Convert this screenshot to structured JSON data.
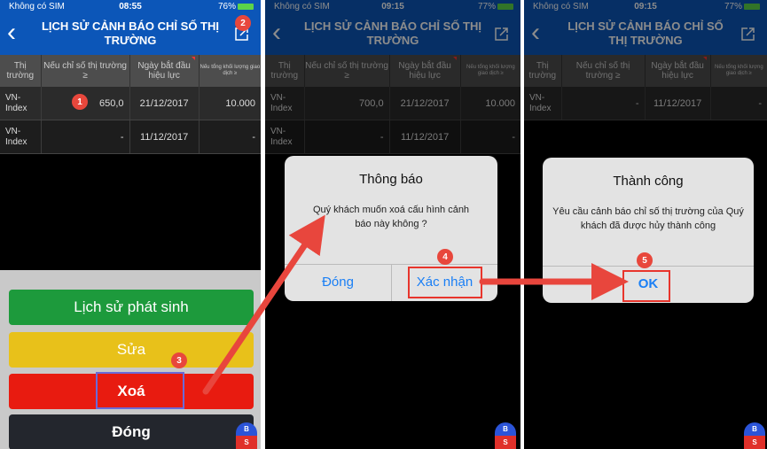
{
  "header": {
    "title": "LỊCH SỬ CẢNH BÁO CHỈ SỐ THỊ TRƯỜNG"
  },
  "columns": {
    "c1": "Thị trường",
    "c2": "Nếu chỉ số thị trường ≥",
    "c3": "Ngày bắt đầu hiệu lực",
    "c4": "Nếu tổng khối lượng giao dịch ≥"
  },
  "screen1": {
    "status": {
      "carrier": "Không có SIM",
      "time": "08:55",
      "battery": "76%"
    },
    "rows": [
      {
        "market": "VN-Index",
        "threshold": "650,0",
        "date": "21/12/2017",
        "volume": "10.000"
      },
      {
        "market": "VN-Index",
        "threshold": "-",
        "date": "11/12/2017",
        "volume": "-"
      }
    ],
    "actions": {
      "history": "Lịch sử phát sinh",
      "edit": "Sửa",
      "delete": "Xoá",
      "close": "Đóng"
    },
    "badges": {
      "b1": "1",
      "b2": "2",
      "b3": "3"
    }
  },
  "screen2": {
    "status": {
      "carrier": "Không có SIM",
      "time": "09:15",
      "battery": "77%"
    },
    "rows": [
      {
        "market": "VN-Index",
        "threshold": "700,0",
        "date": "21/12/2017",
        "volume": "10.000"
      },
      {
        "market": "VN-Index",
        "threshold": "-",
        "date": "11/12/2017",
        "volume": "-"
      }
    ],
    "dialog": {
      "title": "Thông báo",
      "message": "Quý khách muốn xoá cấu hình cảnh báo này không ?",
      "cancel": "Đóng",
      "confirm": "Xác nhận"
    },
    "badges": {
      "b4": "4"
    }
  },
  "screen3": {
    "status": {
      "carrier": "Không có SIM",
      "time": "09:15",
      "battery": "77%"
    },
    "rows": [
      {
        "market": "VN-Index",
        "threshold": "-",
        "date": "11/12/2017",
        "volume": "-"
      }
    ],
    "dialog": {
      "title": "Thành công",
      "message": "Yêu cầu cảnh báo chỉ số thị trường của Quý khách đã được hủy thành công",
      "ok": "OK"
    },
    "badges": {
      "b5": "5"
    }
  },
  "fab": {
    "b": "B",
    "s": "S"
  },
  "colors": {
    "header": "#0c56b8",
    "history_button": "#1d9a3c",
    "edit_button": "#e8c11a",
    "delete_button": "#e81b10",
    "close_button": "#23262d",
    "annotation_red": "#e8352c",
    "dialog_link": "#1a7ff5"
  }
}
